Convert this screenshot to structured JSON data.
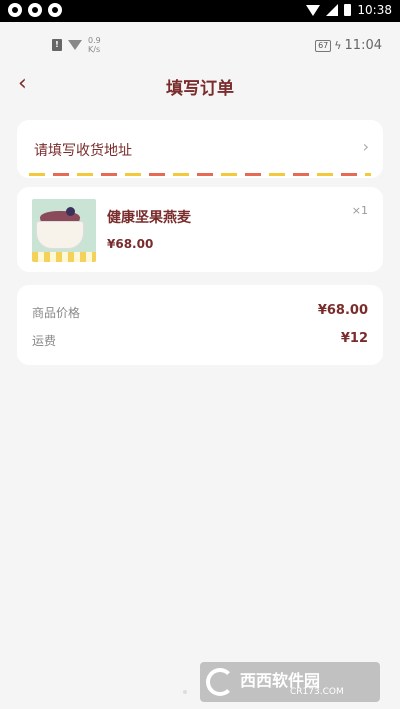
{
  "system_bar": {
    "time": "10:38"
  },
  "app_status": {
    "sim_label": "!",
    "net_speed_value": "0.9",
    "net_speed_unit": "K/s",
    "battery": "67",
    "time": "11:04"
  },
  "header": {
    "title": "填写订单",
    "back_icon": "chevron-left-icon"
  },
  "address": {
    "label": "请填写收货地址",
    "chevron_icon": "chevron-right-icon",
    "stripe_colors": [
      "#f1c93b",
      "#e66b55"
    ]
  },
  "product": {
    "name": "健康坚果燕麦",
    "price": "¥68.00",
    "qty": "×1"
  },
  "summary": {
    "rows": [
      {
        "label": "商品价格",
        "value": "¥68.00"
      },
      {
        "label": "运费",
        "value": "¥12"
      }
    ]
  },
  "watermark": {
    "text": "西西软件园",
    "sub": "CR173.COM"
  },
  "colors": {
    "accent": "#7a2c2c",
    "background": "#f5f5f5",
    "card": "#ffffff"
  }
}
